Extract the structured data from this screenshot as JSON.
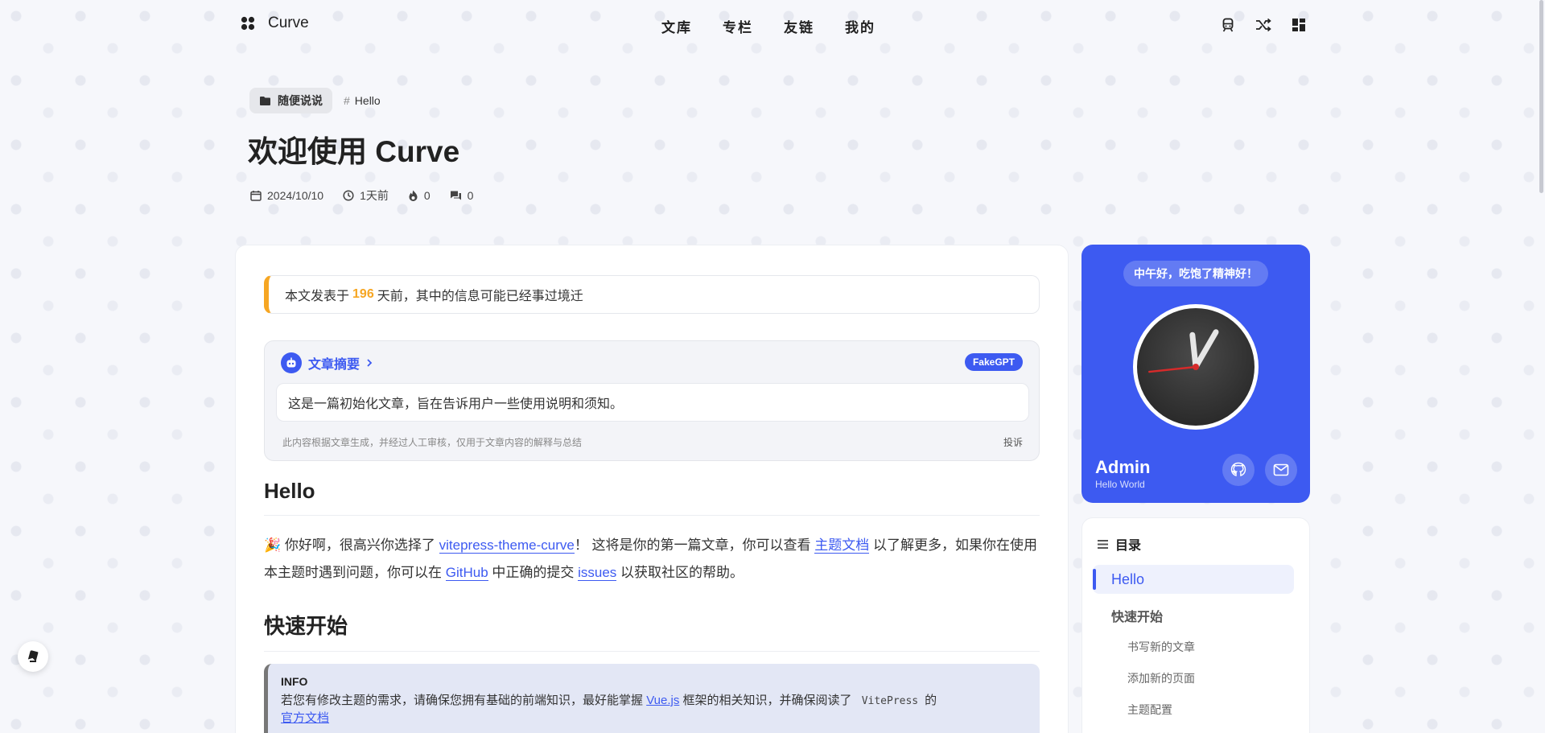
{
  "nav": {
    "brand": "Curve",
    "menu": [
      "文库",
      "专栏",
      "友链",
      "我的"
    ],
    "icons": [
      "train-icon",
      "shuffle-icon",
      "dashboard-icon"
    ]
  },
  "post": {
    "category": "随便说说",
    "tag": "Hello",
    "title": "欢迎使用 Curve",
    "date": "2024/10/10",
    "relative_time": "1天前",
    "hot": "0",
    "comments": "0"
  },
  "notice": {
    "prefix": "本文发表于",
    "days": "196",
    "suffix": "天前，其中的信息可能已经事过境迁"
  },
  "ai": {
    "title": "文章摘要",
    "badge": "FakeGPT",
    "summary": "这是一篇初始化文章，旨在告诉用户一些使用说明和须知。",
    "disclaimer": "此内容根据文章生成，并经过人工审核，仅用于文章内容的解释与总结",
    "report": "投诉"
  },
  "content": {
    "h_hello": "Hello",
    "p1_emoji": "🎉",
    "p1_a": "你好啊，很高兴你选择了",
    "link_theme": "vitepress-theme-curve",
    "p1_b": "！ 这将是你的第一篇文章，你可以查看",
    "link_docs": "主题文档",
    "p1_c": "以了解更多，如果你在使用本主题时遇到问题，你可以在",
    "link_github": "GitHub",
    "p1_d": "中正确的提交",
    "link_issues": "issues",
    "p1_e": "以获取社区的帮助。",
    "h_quick": "快速开始",
    "info_title": "INFO",
    "info_a": "若您有修改主题的需求，请确保您拥有基础的前端知识，最好能掌握",
    "link_vue": "Vue.js",
    "info_b": "框架的相关知识，并确保阅读了",
    "code_vp": "VitePress",
    "info_c": "的",
    "link_official": "官方文档"
  },
  "profile": {
    "greeting": "中午好，吃饱了精神好！",
    "name": "Admin",
    "motto": "Hello World",
    "clock": {
      "hour": 11.8,
      "minute": 5,
      "second": 44
    }
  },
  "toc": {
    "title": "目录",
    "items": [
      {
        "label": "Hello",
        "level": 1,
        "active": true
      },
      {
        "label": "快速开始",
        "level": 1,
        "active": false
      },
      {
        "label": "书写新的文章",
        "level": 2,
        "active": false
      },
      {
        "label": "添加新的页面",
        "level": 2,
        "active": false
      },
      {
        "label": "主题配置",
        "level": 2,
        "active": false
      }
    ]
  },
  "colors": {
    "accent": "#3d5af1",
    "warning": "#f6a623"
  }
}
